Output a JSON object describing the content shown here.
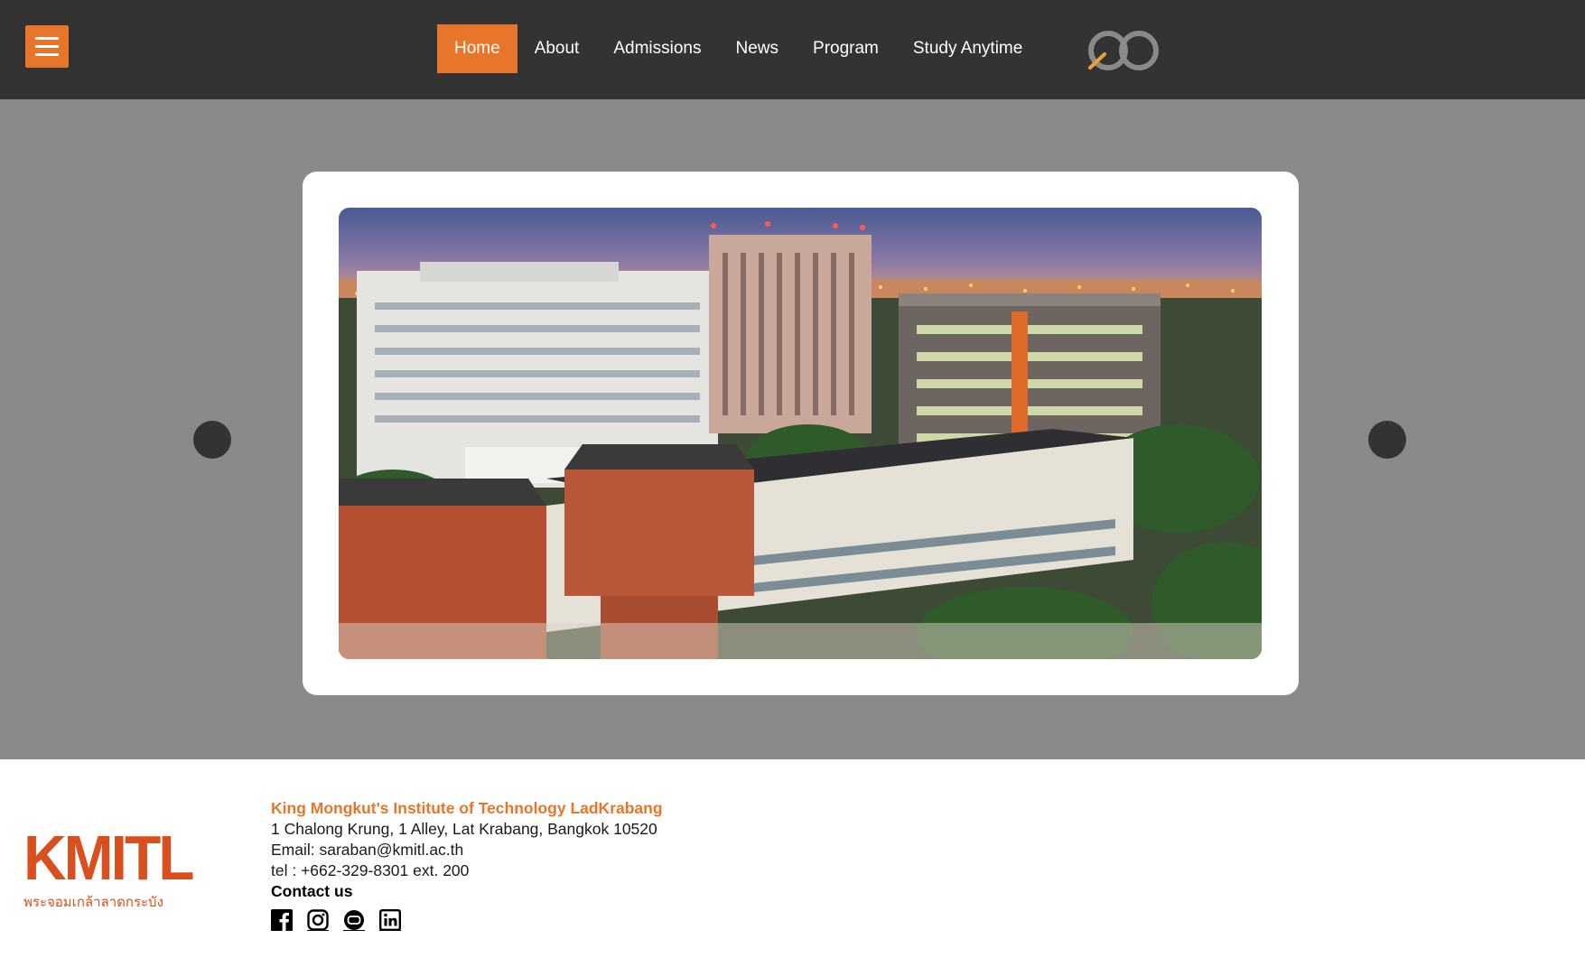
{
  "header": {
    "nav": [
      {
        "label": "Home",
        "active": true
      },
      {
        "label": "About",
        "active": false
      },
      {
        "label": "Admissions",
        "active": false
      },
      {
        "label": "News",
        "active": false
      },
      {
        "label": "Program",
        "active": false
      },
      {
        "label": "Study Anytime",
        "active": false
      }
    ],
    "menu_icon": "hamburger-menu-icon",
    "logo_icon": "infinity-logo-icon"
  },
  "carousel": {
    "image_alt_icon": "campus-photo",
    "prev_icon": "previous-slide-icon",
    "next_icon": "next-slide-icon"
  },
  "footer": {
    "logo_text": "KMITL",
    "logo_subtitle": "พระจอมเกล้าลาดกระบัง",
    "org_name": "King Mongkut's Institute of Technology LadKrabang",
    "address": "1 Chalong Krung, 1 Alley, Lat Krabang, Bangkok 10520",
    "email": "Email: saraban@kmitl.ac.th",
    "tel": "tel : +662-329-8301 ext. 200",
    "contact_heading": "Contact us",
    "social": [
      "facebook-icon",
      "instagram-icon",
      "youtube-icon",
      "linkedin-icon"
    ]
  },
  "colors": {
    "accent": "#e8762a",
    "header_bg": "#333333",
    "hero_bg": "#8a8a8a",
    "logo_red": "#d9501e"
  }
}
